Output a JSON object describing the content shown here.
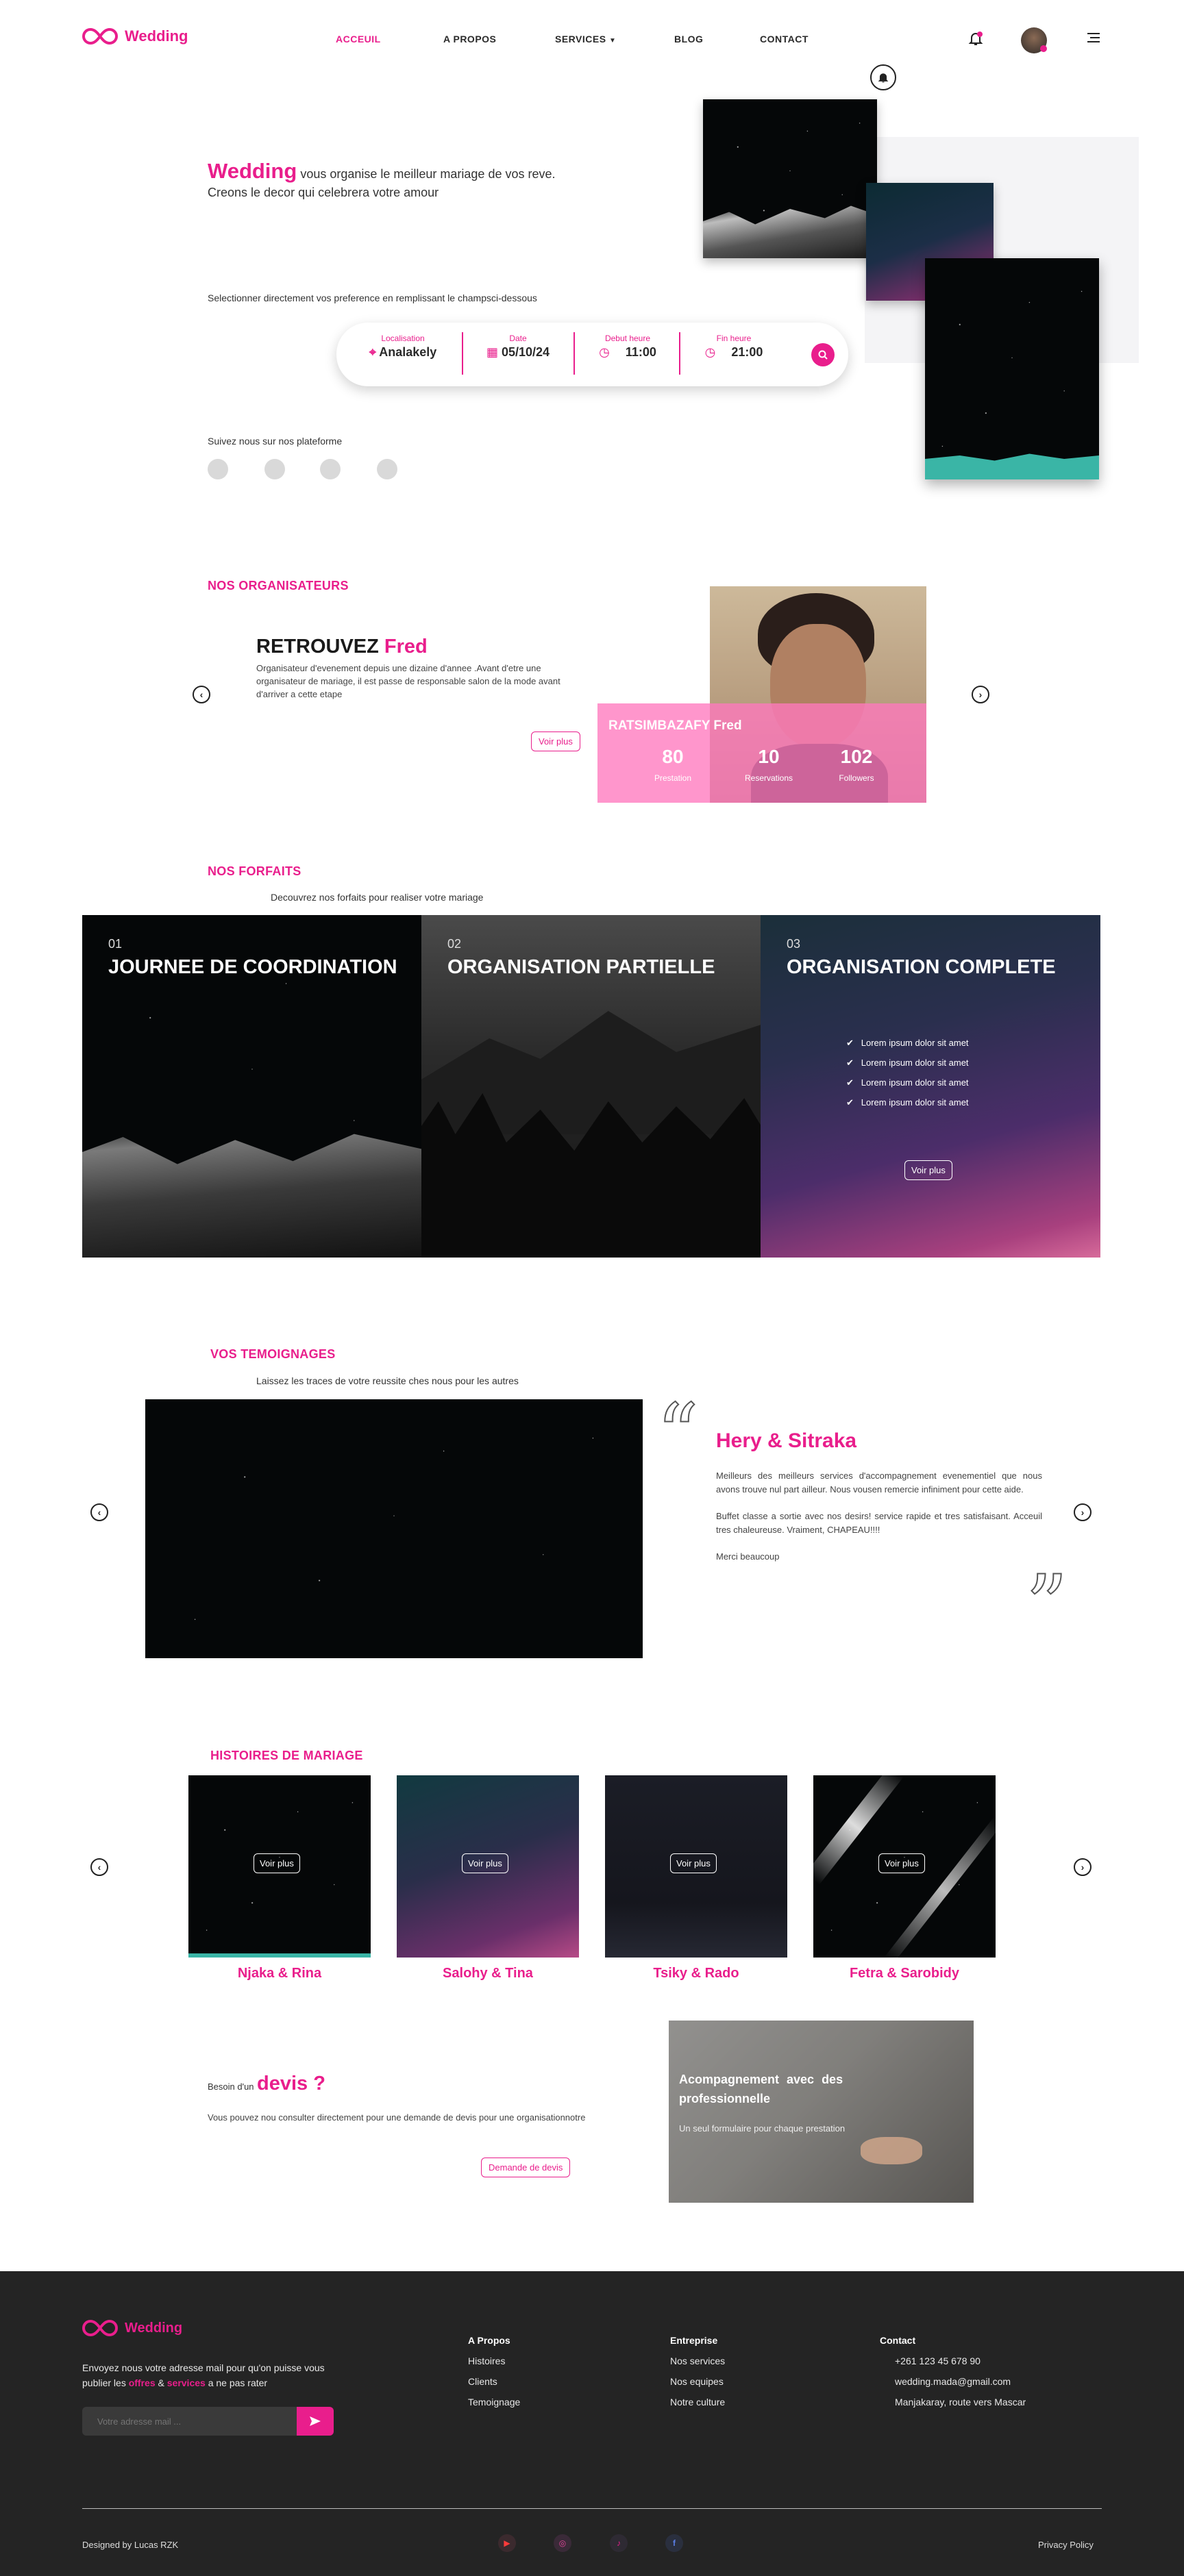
{
  "brand": {
    "name": "Wedding"
  },
  "nav": {
    "items": [
      "ACCEUIL",
      "A PROPOS",
      "SERVICES",
      "BLOG",
      "CONTACT"
    ],
    "active_color": "#e91e8c"
  },
  "hero": {
    "brand_word": "Wedding",
    "line1": "vous organise le meilleur mariage de vos reve.",
    "line2": "Creons le decor qui celebrera votre amour",
    "select_text": "Selectionner directement vos preference en remplissant le champsci-dessous",
    "follow_text": "Suivez nous sur nos plateforme"
  },
  "search": {
    "fields": [
      {
        "label": "Localisation",
        "value": "Analakely",
        "icon": "location-pin-icon"
      },
      {
        "label": "Date",
        "value": "05/10/24",
        "icon": "calendar-icon"
      },
      {
        "label": "Debut heure",
        "value": "11:00",
        "icon": "clock-icon"
      },
      {
        "label": "Fin heure",
        "value": "21:00",
        "icon": "clock-icon"
      }
    ]
  },
  "organisers": {
    "heading": "NOS ORGANISATEURS",
    "retrouvez": "RETROUVEZ",
    "first": "Fred",
    "desc": "Organisateur d'evenement depuis une dizaine d'annee .Avant d'etre une organisateur de mariage, il est passe de responsable salon de la mode avant d'arriver a cette etape",
    "button": "Voir plus",
    "card_name": "RATSIMBAZAFY",
    "card_first": "Fred",
    "stats": [
      {
        "value": "80",
        "label": "Prestation"
      },
      {
        "value": "10",
        "label": "Reservations"
      },
      {
        "value": "102",
        "label": "Followers"
      }
    ]
  },
  "forfaits": {
    "heading": "NOS FORFAITS",
    "subtitle": "Decouvrez nos forfaits pour realiser votre mariage",
    "cards": [
      {
        "num": "01",
        "title": "JOURNEE DE COORDINATION"
      },
      {
        "num": "02",
        "title": "ORGANISATION PARTIELLE"
      },
      {
        "num": "03",
        "title": "ORGANISATION COMPLETE",
        "features": [
          "Lorem ipsum dolor sit amet",
          "Lorem ipsum dolor sit amet",
          "Lorem ipsum dolor sit amet",
          "Lorem ipsum dolor sit amet"
        ],
        "button": "Voir plus"
      }
    ]
  },
  "temoignages": {
    "heading": "VOS TEMOIGNAGES",
    "subtitle": "Laissez les traces de votre reussite ches nous pour les autres",
    "couple": "Hery & Sitraka",
    "p1": "Meilleurs des meilleurs services d'accompagnement evenementiel que nous avons trouve nul part ailleur. Nous vousen remercie infiniment pour cette aide.",
    "p2": "Buffet classe a sortie avec nos desirs! service rapide et tres satisfaisant. Acceuil tres chaleureuse. Vraiment, CHAPEAU!!!!",
    "p3": "Merci beaucoup"
  },
  "histoires": {
    "heading": "HISTOIRES DE MARIAGE",
    "button": "Voir plus",
    "items": [
      "Njaka & Rina",
      "Salohy & Tina",
      "Tsiky & Rado",
      "Fetra & Sarobidy"
    ]
  },
  "devis": {
    "small": "Besoin d'un",
    "big": "devis ?",
    "desc": "Vous pouvez nou consulter directement pour une demande de devis pour une organisationnotre",
    "button": "Demande de devis",
    "card_title": "Acompagnement avec des professionnelle",
    "card_sub": "Un seul formulaire pour chaque prestation"
  },
  "footer": {
    "brand": "Wedding",
    "text_pre": "Envoyez nous votre adresse mail pour qu'on puisse vous publier les",
    "w1": "offres",
    "amp": "&",
    "w2": "services",
    "text_post": "a ne pas rater",
    "email_placeholder": "Votre adresse mail ...",
    "col1": {
      "title": "A Propos",
      "items": [
        "Histoires",
        "Clients",
        "Temoignage"
      ]
    },
    "col2": {
      "title": "Entreprise",
      "items": [
        "Nos services",
        "Nos equipes",
        "Notre culture"
      ]
    },
    "col3": {
      "title": "Contact",
      "items": [
        "+261 123 45 678 90",
        "wedding.mada@gmail.com",
        "Manjakaray, route vers Mascar"
      ]
    },
    "designed": "Designed by Lucas RZK",
    "privacy": "Privacy Policy"
  },
  "colors": {
    "accent": "#e91e8c",
    "footer_bg": "#242424"
  }
}
